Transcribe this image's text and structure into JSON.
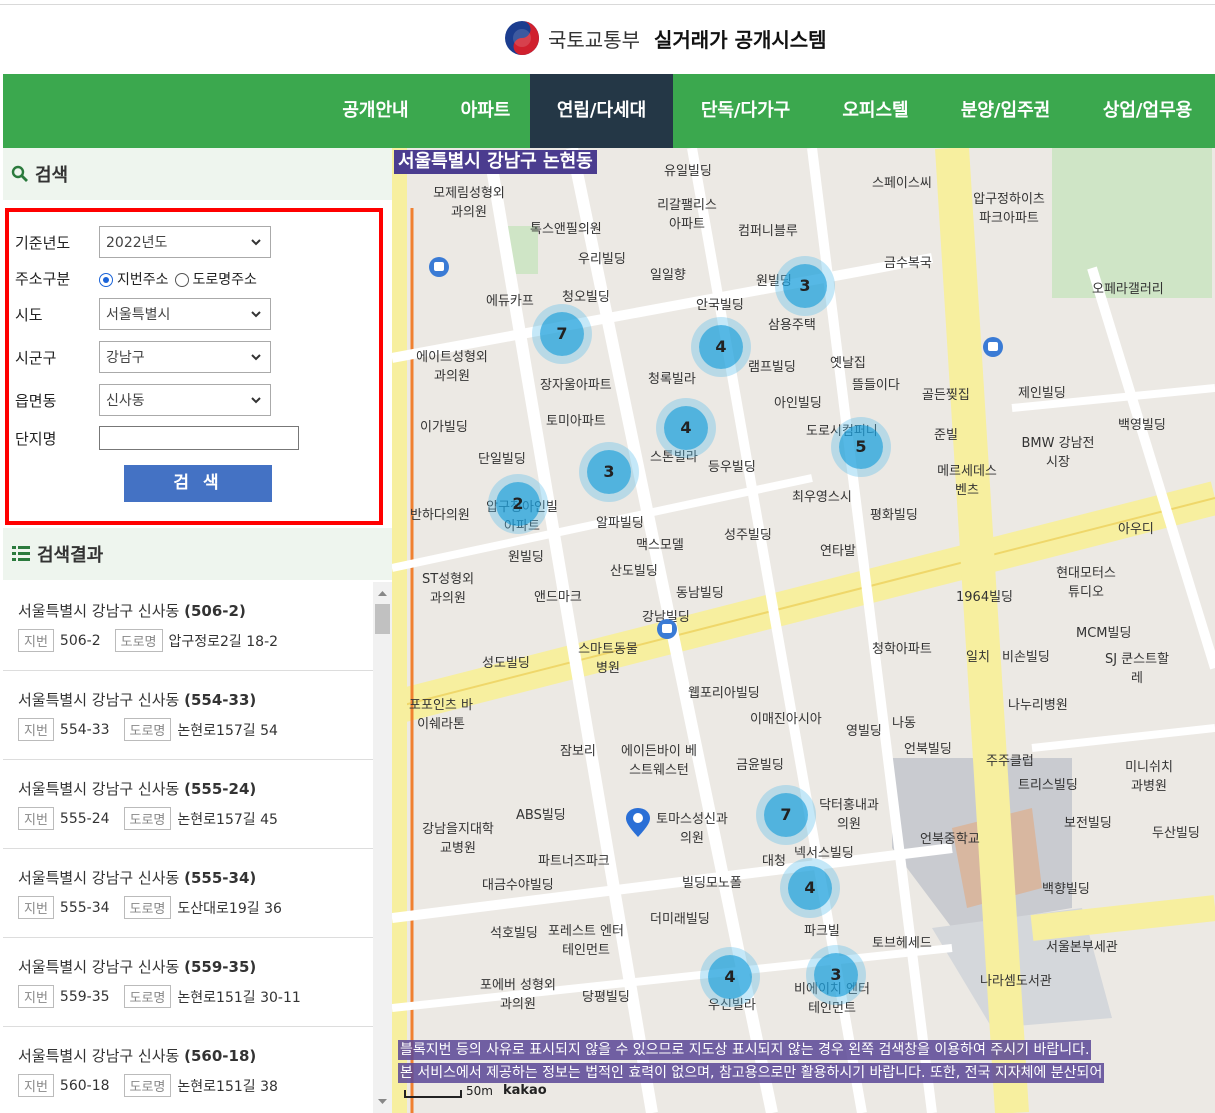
{
  "header": {
    "org": "국토교통부",
    "system": "실거래가 공개시스템"
  },
  "nav": {
    "items": [
      "공개안내",
      "아파트",
      "연립/다세대",
      "단독/다가구",
      "오피스텔",
      "분양/입주권",
      "상업/업무용"
    ],
    "active": "연립/다세대"
  },
  "search": {
    "heading": "검색",
    "year_label": "기준년도",
    "year_value": "2022년도",
    "addr_type_label": "주소구분",
    "addr_type_options": [
      "지번주소",
      "도로명주소"
    ],
    "addr_type_selected": "지번주소",
    "sido_label": "시도",
    "sido_value": "서울특별시",
    "sigungu_label": "시군구",
    "sigungu_value": "강남구",
    "dong_label": "읍면동",
    "dong_value": "신사동",
    "complex_label": "단지명",
    "complex_value": "",
    "button": "검 색"
  },
  "results": {
    "heading": "검색결과",
    "jibun_tag": "지번",
    "road_tag": "도로명",
    "items": [
      {
        "prefix": "서울특별시 강남구 신사동",
        "code": "(506-2)",
        "jibun": "506-2",
        "road": "압구정로2길 18-2"
      },
      {
        "prefix": "서울특별시 강남구 신사동",
        "code": "(554-33)",
        "jibun": "554-33",
        "road": "논현로157길 54"
      },
      {
        "prefix": "서울특별시 강남구 신사동",
        "code": "(555-24)",
        "jibun": "555-24",
        "road": "논현로157길 45"
      },
      {
        "prefix": "서울특별시 강남구 신사동",
        "code": "(555-34)",
        "jibun": "555-34",
        "road": "도산대로19길 36"
      },
      {
        "prefix": "서울특별시 강남구 신사동",
        "code": "(559-35)",
        "jibun": "559-35",
        "road": "논현로151길 30-11"
      },
      {
        "prefix": "서울특별시 강남구 신사동",
        "code": "(560-18)",
        "jibun": "560-18",
        "road": "논현로151길 38"
      }
    ]
  },
  "map": {
    "location": "서울특별시 강남구 논현동",
    "clusters": [
      "3",
      "7",
      "4",
      "4",
      "5",
      "3",
      "2",
      "7",
      "4",
      "4",
      "3"
    ],
    "labels": [
      "유일빌딩",
      "모제림성형외과의원",
      "톡스앤필의원",
      "리갈팰리스아파트",
      "컴퍼니블루",
      "스페이스씨",
      "압구정하이츠파크아파트",
      "우리빌딩",
      "일일향",
      "금수복국",
      "원빌딩",
      "에듀카프",
      "청오빌딩",
      "안국빌딩",
      "삼용주택",
      "오페라갤러리",
      "에이트성형외과의원",
      "장자울아파트",
      "청록빌라",
      "램프빌딩",
      "옛날집",
      "뜰들이다",
      "골든찢집",
      "제인빌딩",
      "토미아파트",
      "아인빌딩",
      "이가빌딩",
      "도로시컴퍼니",
      "준빌",
      "백영빌딩",
      "단일빌딩",
      "스톤빌라",
      "등우빌딩",
      "BMW 강남전시장",
      "메르세데스 벤츠",
      "반하다의원",
      "압구정아인빌아파트",
      "알파빌딩",
      "최우영스시",
      "평화빌딩",
      "아우디",
      "원빌딩",
      "맥스모델",
      "성주빌딩",
      "연타발",
      "ST성형외과의원",
      "앤드마크",
      "산도빌딩",
      "동남빌딩",
      "현대모터스튜디오",
      "1964빌딩",
      "강남빌딩",
      "MCM빌딩",
      "청학아파트",
      "일치",
      "비손빌딩",
      "SJ 쿤스트할레",
      "성도빌딩",
      "스마트동물병원",
      "포포인츠 바이쉐라톤",
      "웹포리아빌딩",
      "이매진아시아",
      "영빌딩",
      "나동",
      "나누리병원",
      "언북빌딩",
      "잠보리",
      "에이든바이 베스트웨스턴",
      "금윤빌딩",
      "주주클럽",
      "트리스빌딩",
      "미니쉬치과병원",
      "ABS빌딩",
      "토마스성신과의원",
      "닥터홍내과의원",
      "강남을지대학교병원",
      "대청",
      "넥서스빌딩",
      "언북중학교",
      "보전빌딩",
      "두산빌딩",
      "파트너즈파크",
      "대금수야빌딩",
      "빌딩모노폴",
      "백향빌딩",
      "석호빌딩",
      "포레스트 엔터테인먼트",
      "더미래빌딩",
      "파크빌",
      "토브헤세드",
      "서울본부세관",
      "포에버 성형외과의원",
      "당평빌딩",
      "우신빌라",
      "비에이치 엔터테인먼트",
      "나라셈도서관"
    ],
    "notice1": "블록지번 등의 사유로 표시되지 않을 수 있으므로 지도상 표시되지 않는 경우 왼쪽 검색창을 이용하여 주시기 바랍니다.",
    "notice2": "본 서비스에서 제공하는 정보는 법적인 효력이 없으며, 참고용으로만 활용하시기 바랍니다. 또한, 전국 지자체에 분산되어",
    "scale": "50m",
    "brand": "kakao"
  }
}
